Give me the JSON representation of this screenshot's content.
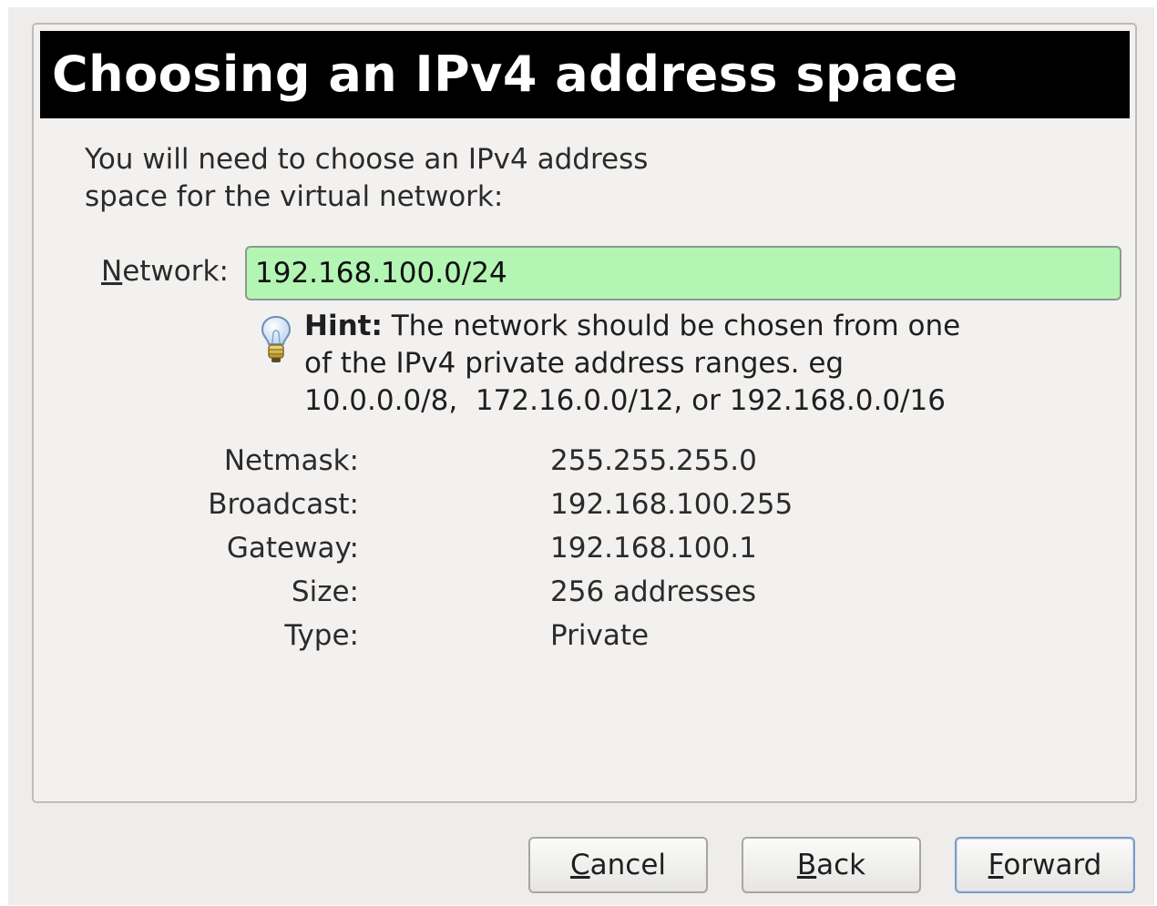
{
  "header": {
    "title": "Choosing an IPv4 address space"
  },
  "intro": {
    "line1": "You will need to choose an IPv4 address",
    "line2": "space for the virtual network:"
  },
  "network": {
    "label_mnemonic": "N",
    "label_rest": "etwork:",
    "value": "192.168.100.0/24",
    "valid_color": "#b3f5b3"
  },
  "hint": {
    "icon": "lightbulb-icon",
    "bold": "Hint:",
    "line1": " The network should be chosen from one",
    "line2": "of the IPv4 private address ranges. eg",
    "line3": "10.0.0.0/8,  172.16.0.0/12, or 192.168.0.0/16"
  },
  "details": [
    {
      "label": "Netmask:",
      "value": "255.255.255.0"
    },
    {
      "label": "Broadcast:",
      "value": "192.168.100.255"
    },
    {
      "label": "Gateway:",
      "value": "192.168.100.1"
    },
    {
      "label": "Size:",
      "value": "256 addresses"
    },
    {
      "label": "Type:",
      "value": "Private"
    }
  ],
  "buttons": {
    "cancel": {
      "mnemonic": "C",
      "rest": "ancel"
    },
    "back": {
      "mnemonic": "B",
      "rest": "ack"
    },
    "forward": {
      "mnemonic": "F",
      "rest": "orward"
    }
  }
}
